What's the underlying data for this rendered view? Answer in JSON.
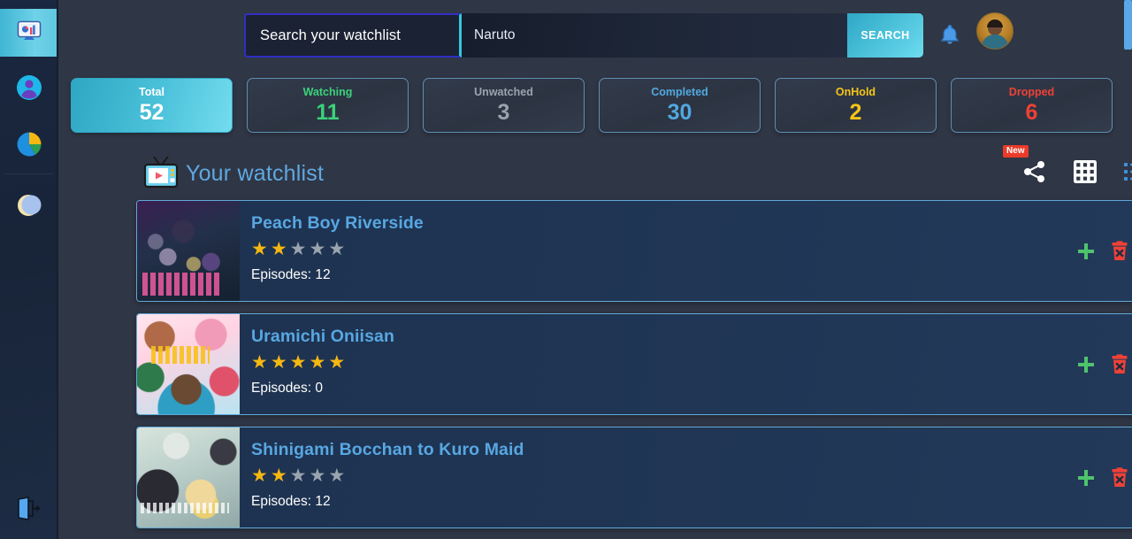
{
  "sidebar": {
    "items": [
      {
        "name": "dashboard",
        "icon": "dashboard-monitor-icon",
        "active": true
      },
      {
        "name": "profile",
        "icon": "user-profile-icon",
        "active": false
      },
      {
        "name": "statistics",
        "icon": "pie-chart-icon",
        "active": false
      },
      {
        "name": "theme",
        "icon": "moon-icon",
        "active": false
      }
    ],
    "logout": {
      "name": "logout",
      "icon": "logout-icon"
    }
  },
  "topbar": {
    "search_label": "Search your watchlist",
    "search_value": "Naruto",
    "search_placeholder": "Naruto",
    "search_button": "SEARCH",
    "bell_icon": "notification-bell-icon",
    "avatar_icon": "user-avatar"
  },
  "stats": [
    {
      "label": "Total",
      "value": "52",
      "label_color": "#ffffff",
      "value_color": "#ffffff",
      "highlight": true
    },
    {
      "label": "Watching",
      "value": "11",
      "label_color": "#3ad27a",
      "value_color": "#3ad27a",
      "highlight": false
    },
    {
      "label": "Unwatched",
      "value": "3",
      "label_color": "#9aa3ad",
      "value_color": "#9aa3ad",
      "highlight": false
    },
    {
      "label": "Completed",
      "value": "30",
      "label_color": "#52a8e0",
      "value_color": "#52a8e0",
      "highlight": false
    },
    {
      "label": "OnHold",
      "value": "2",
      "label_color": "#f5c518",
      "value_color": "#f5c518",
      "highlight": false
    },
    {
      "label": "Dropped",
      "value": "6",
      "label_color": "#ef4136",
      "value_color": "#ef4136",
      "highlight": false
    }
  ],
  "watchlist": {
    "title": "Your watchlist",
    "title_icon": "tv-icon",
    "actions": {
      "share_icon": "share-icon",
      "share_badge": "New",
      "grid_icon": "grid-view-icon",
      "list_icon": "list-view-icon"
    },
    "items": [
      {
        "title": "Peach Boy Riverside",
        "rating": 2,
        "max_rating": 5,
        "episodes_label": "Episodes: 12",
        "poster": "peach-boy-riverside-poster",
        "add_icon": "plus-icon",
        "delete_icon": "trash-delete-icon"
      },
      {
        "title": "Uramichi Oniisan",
        "rating": 5,
        "max_rating": 5,
        "episodes_label": "Episodes: 0",
        "poster": "uramichi-oniisan-poster",
        "add_icon": "plus-icon",
        "delete_icon": "trash-delete-icon"
      },
      {
        "title": "Shinigami Bocchan to Kuro Maid",
        "rating": 2,
        "max_rating": 5,
        "episodes_label": "Episodes: 12",
        "poster": "shinigami-bocchan-to-kuro-maid-poster",
        "add_icon": "plus-icon",
        "delete_icon": "trash-delete-icon"
      }
    ]
  },
  "colors": {
    "accent_cyan": "#4cc2da",
    "card_border": "#61a9d8",
    "title_blue": "#58a7e2",
    "star_on": "#f5b711",
    "star_off": "#9aa4ae",
    "delete_red": "#ef4136",
    "add_green": "#4fc36b",
    "badge_red": "#ea3b2a",
    "bg_main": "#2f3645",
    "bg_sidebar": "#1a2740"
  }
}
